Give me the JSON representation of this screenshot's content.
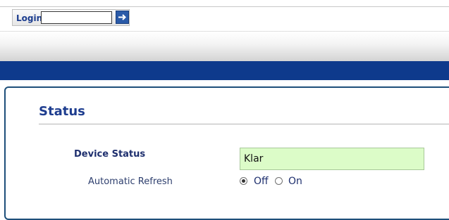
{
  "login": {
    "label": "Login",
    "password_value": "",
    "go_icon": "arrow-right-icon"
  },
  "status_page": {
    "title": "Status",
    "device_status_label": "Device Status",
    "device_status_value": "Klar",
    "refresh_label": "Automatic Refresh",
    "refresh_options": [
      {
        "label": "Off",
        "selected": true
      },
      {
        "label": "On",
        "selected": false
      }
    ]
  },
  "colors": {
    "nav_bar": "#0e3a8c",
    "title": "#1e3d8f",
    "status_ok_bg": "#dcfcc8"
  }
}
